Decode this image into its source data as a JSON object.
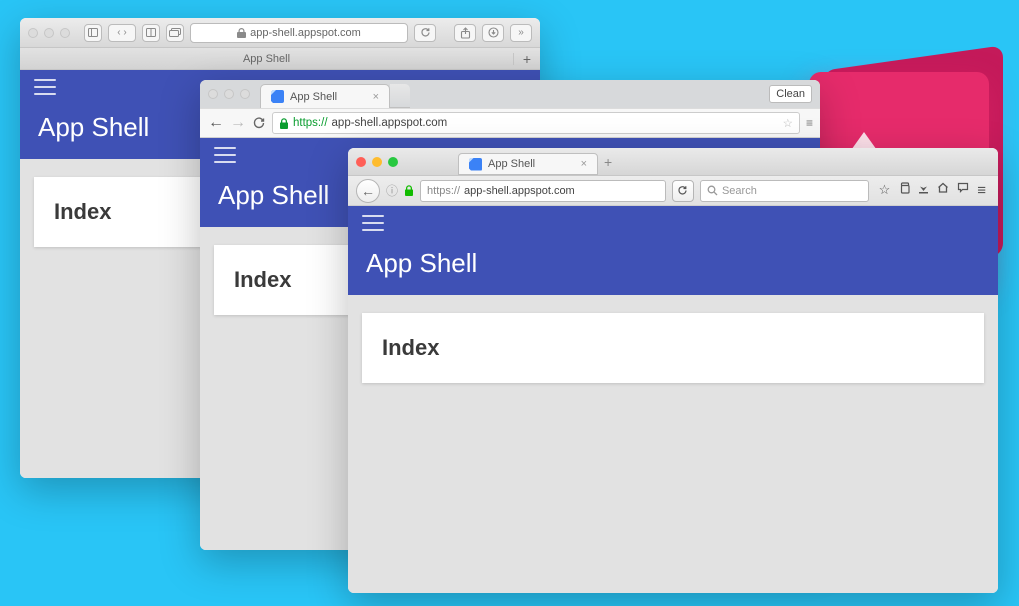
{
  "safari": {
    "url_host": "app-shell.appspot.com",
    "tab_title": "App Shell"
  },
  "chrome": {
    "tab_title": "App Shell",
    "url_scheme": "https://",
    "url_host": "app-shell.appspot.com",
    "clean_label": "Clean"
  },
  "firefox": {
    "tab_title": "App Shell",
    "url_scheme": "https://",
    "url_host": "app-shell.appspot.com",
    "search_placeholder": "Search"
  },
  "app": {
    "title": "App Shell",
    "heading": "Index"
  }
}
